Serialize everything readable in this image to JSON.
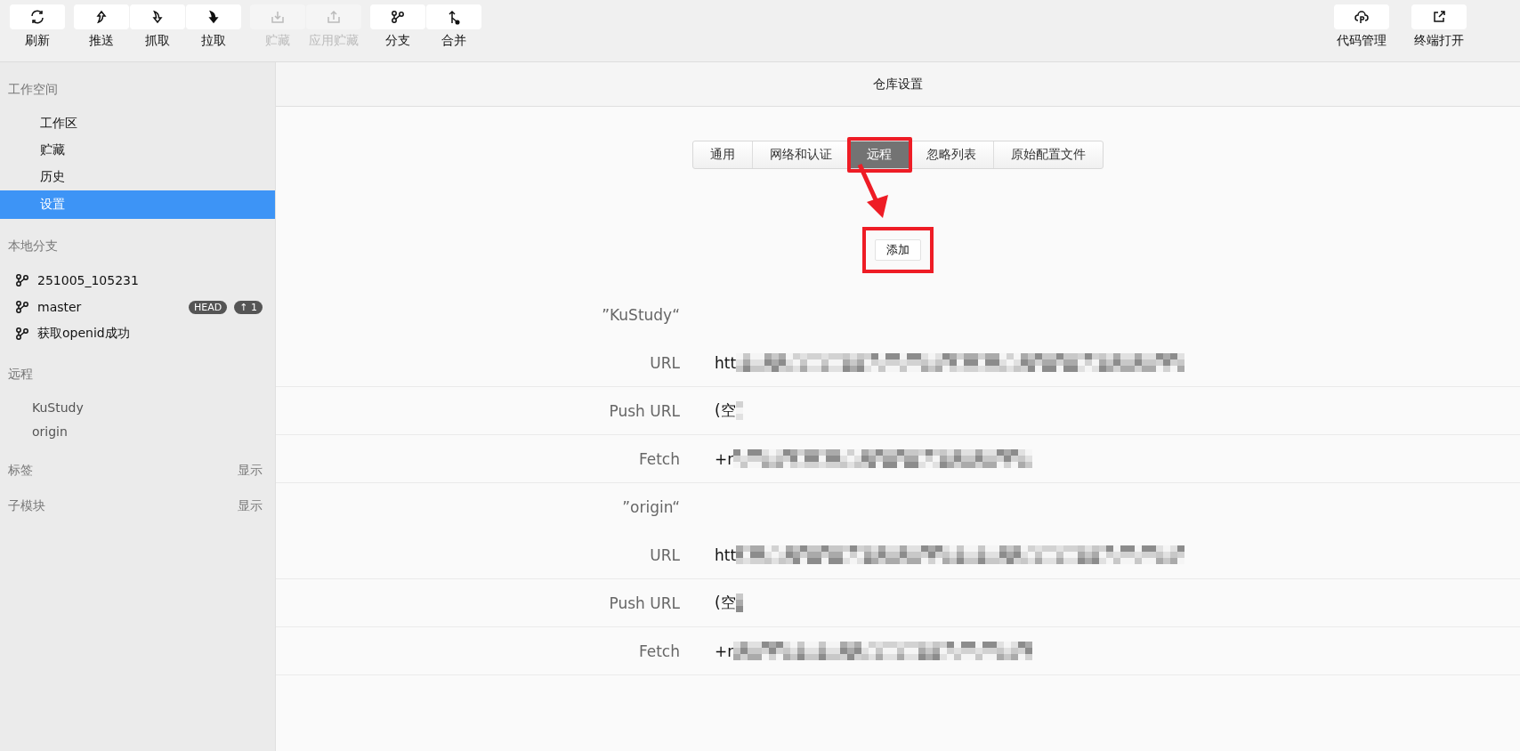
{
  "toolbar": {
    "groups": [
      {
        "buttons": [
          {
            "label": "刷新",
            "kind": "refresh",
            "disabled": false
          }
        ]
      },
      {
        "buttons": [
          {
            "label": "推送",
            "kind": "push",
            "disabled": false
          },
          {
            "label": "抓取",
            "kind": "fetch",
            "disabled": false
          },
          {
            "label": "拉取",
            "kind": "pull",
            "disabled": false
          }
        ]
      },
      {
        "buttons": [
          {
            "label": "贮藏",
            "kind": "stash",
            "disabled": true
          },
          {
            "label": "应用贮藏",
            "kind": "unstash",
            "disabled": true
          }
        ]
      },
      {
        "buttons": [
          {
            "label": "分支",
            "kind": "branch",
            "disabled": false
          },
          {
            "label": "合并",
            "kind": "merge",
            "disabled": false
          }
        ]
      }
    ],
    "right": [
      {
        "label": "代码管理",
        "kind": "cloud",
        "disabled": false
      },
      {
        "label": "终端打开",
        "kind": "external",
        "disabled": false
      }
    ]
  },
  "sidebar": {
    "sections": [
      {
        "title": "工作空间",
        "items": [
          {
            "label": "工作区",
            "kind": "nav",
            "selected": false
          },
          {
            "label": "贮藏",
            "kind": "nav",
            "selected": false
          },
          {
            "label": "历史",
            "kind": "nav",
            "selected": false
          },
          {
            "label": "设置",
            "kind": "nav",
            "selected": true
          }
        ]
      },
      {
        "title": "本地分支",
        "items": [
          {
            "label": "251005_105231",
            "kind": "branch",
            "selected": false
          },
          {
            "label": "master",
            "kind": "branch",
            "selected": false,
            "badges": [
              "HEAD",
              "↑ 1"
            ]
          },
          {
            "label": "获取openid成功",
            "kind": "branch",
            "selected": false
          }
        ]
      },
      {
        "title": "远程",
        "items": [
          {
            "label": "KuStudy",
            "kind": "remote",
            "selected": false
          },
          {
            "label": "origin",
            "kind": "remote",
            "selected": false
          }
        ]
      },
      {
        "title": "标签",
        "action": "显示"
      },
      {
        "title": "子模块",
        "action": "显示"
      }
    ]
  },
  "content": {
    "title": "仓库设置",
    "tabs": [
      {
        "label": "通用",
        "selected": false,
        "highlighted": false
      },
      {
        "label": "网络和认证",
        "selected": false,
        "highlighted": false
      },
      {
        "label": "远程",
        "selected": true,
        "highlighted": true
      },
      {
        "label": "忽略列表",
        "selected": false,
        "highlighted": false
      },
      {
        "label": "原始配置文件",
        "selected": false,
        "highlighted": false
      }
    ],
    "add_button": {
      "label": "添加",
      "highlighted": true
    },
    "remotes": [
      {
        "name": "”KuStudy“",
        "fields": [
          {
            "label": "URL",
            "value": "htt",
            "kind": "url"
          },
          {
            "label": "Push URL",
            "value": "(空",
            "kind": "push"
          },
          {
            "label": "Fetch",
            "value": "+r",
            "kind": "fetch"
          }
        ]
      },
      {
        "name": "”origin“",
        "fields": [
          {
            "label": "URL",
            "value": "htt",
            "kind": "url"
          },
          {
            "label": "Push URL",
            "value": "(空",
            "kind": "push"
          },
          {
            "label": "Fetch",
            "value": "+r",
            "kind": "fetch"
          }
        ]
      }
    ]
  }
}
